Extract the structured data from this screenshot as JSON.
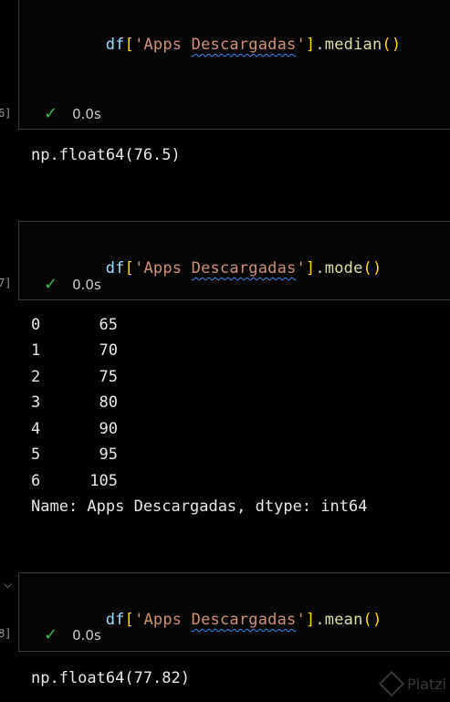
{
  "cells": [
    {
      "code": {
        "var": "df",
        "open": "[",
        "quote_open": "'Apps ",
        "err_word": "Descargadas",
        "quote_close": "'",
        "close": "]",
        "dot": ".",
        "method": "median",
        "parens": "()"
      },
      "exec_count": "6]",
      "status_time": "0.0s",
      "output": "np.float64(76.5)"
    },
    {
      "code": {
        "var": "df",
        "open": "[",
        "quote_open": "'Apps ",
        "err_word": "Descargadas",
        "quote_close": "'",
        "close": "]",
        "dot": ".",
        "method": "mode",
        "parens": "()"
      },
      "exec_count": "7]",
      "status_time": "0.0s",
      "output_rows": [
        {
          "idx": "0",
          "val": "65"
        },
        {
          "idx": "1",
          "val": "70"
        },
        {
          "idx": "2",
          "val": "75"
        },
        {
          "idx": "3",
          "val": "80"
        },
        {
          "idx": "4",
          "val": "90"
        },
        {
          "idx": "5",
          "val": "95"
        },
        {
          "idx": "6",
          "val": "105"
        }
      ],
      "output_footer": "Name: Apps Descargadas, dtype: int64"
    },
    {
      "code": {
        "var": "df",
        "open": "[",
        "quote_open": "'Apps ",
        "err_word": "Descargadas",
        "quote_close": "'",
        "close": "]",
        "dot": ".",
        "method": "mean",
        "parens": "()"
      },
      "exec_count": "8]",
      "status_time": "0.0s",
      "output": "np.float64(77.82)"
    }
  ],
  "icons": {
    "check": "check-icon",
    "chevron": "chevron-down-icon",
    "watermark": "platzi-logo"
  },
  "watermark_text": "Platzi",
  "colors": {
    "check": "#3fb950",
    "string": "#ce9178",
    "method": "#dcdcaa",
    "variable": "#9cdcfe",
    "bracket": "#ffd700",
    "paren": "#da70d6",
    "squiggle": "#3b8eea"
  }
}
